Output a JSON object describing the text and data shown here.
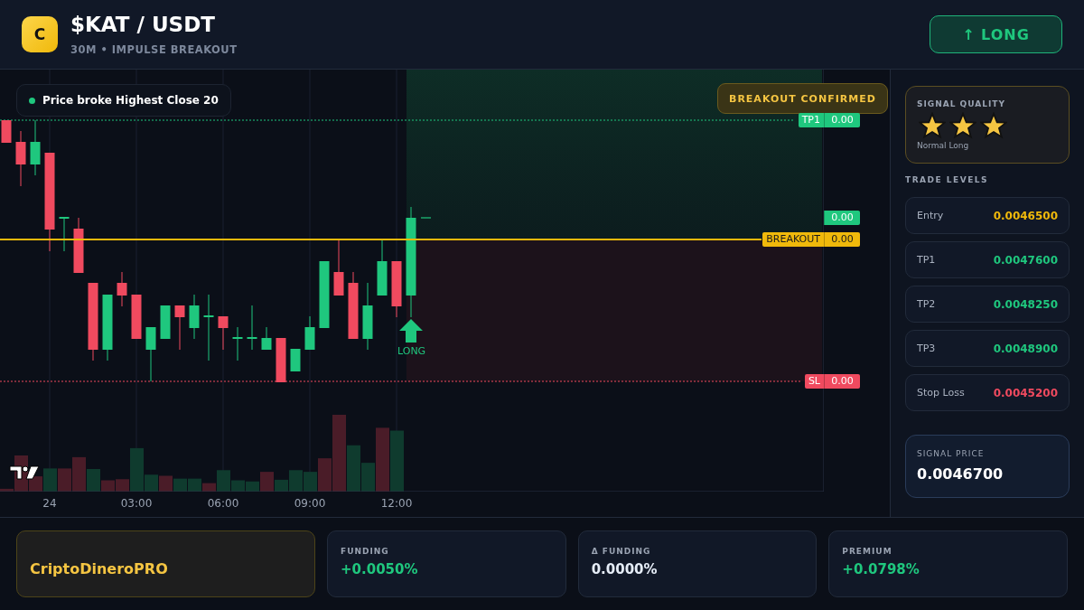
{
  "header": {
    "logo_letter": "C",
    "pair": "$KAT / USDT",
    "subtitle": "30M • IMPULSE BREAKOUT",
    "direction_button": "↑ LONG"
  },
  "chart": {
    "condition_badge": "Price broke Highest Close 20",
    "status_badge": "BREAKOUT CONFIRMED",
    "price_tags": [
      {
        "kind": "tp",
        "label": "TP1",
        "value": "0.00"
      },
      {
        "kind": "last",
        "value": "0.00"
      },
      {
        "kind": "breakout",
        "label": "BREAKOUT",
        "value": "0.00"
      },
      {
        "kind": "sl",
        "label": "SL",
        "value": "0.00"
      }
    ],
    "signal_marker": "LONG",
    "time_labels": [
      "24",
      "03:00",
      "06:00",
      "09:00",
      "12:00"
    ]
  },
  "signal_quality": {
    "title": "SIGNAL QUALITY",
    "stars": 3,
    "caption": "Normal Long"
  },
  "trade_levels": {
    "title": "TRADE LEVELS",
    "rows": [
      {
        "kind": "entry",
        "label": "Entry",
        "value": "0.0046500"
      },
      {
        "kind": "target",
        "label": "TP1",
        "value": "0.0047600"
      },
      {
        "kind": "target",
        "label": "TP2",
        "value": "0.0048250"
      },
      {
        "kind": "target",
        "label": "TP3",
        "value": "0.0048900"
      },
      {
        "kind": "stop",
        "label": "Stop Loss",
        "value": "0.0045200"
      }
    ]
  },
  "signal_price": {
    "label": "SIGNAL PRICE",
    "value": "0.0046700"
  },
  "footer": {
    "brand": "CriptoDineroPRO",
    "stats": [
      {
        "kind": "positive",
        "label": "FUNDING",
        "value": "+0.0050%"
      },
      {
        "kind": "neutral",
        "label": "Δ FUNDING",
        "value": "0.0000%"
      },
      {
        "kind": "positive",
        "label": "PREMIUM",
        "value": "+0.0798%"
      }
    ]
  }
}
